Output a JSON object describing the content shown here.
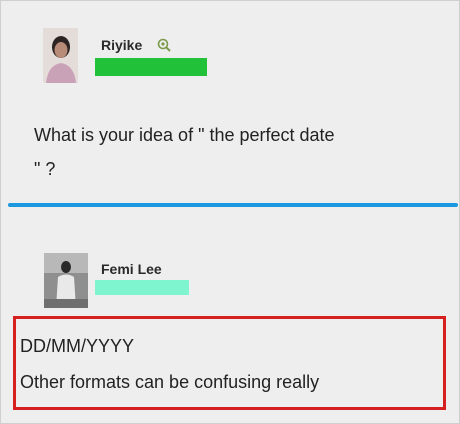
{
  "post": {
    "author": "Riyike",
    "text_line1": "What is your idea of \" the perfect date",
    "text_line2": "\" ?",
    "redaction_color": "#21c13a"
  },
  "reply": {
    "author": "Femi Lee",
    "line1": "DD/MM/YYYY",
    "line2": "Other formats can be confusing really",
    "redaction_color": "#7ef5cf"
  },
  "colors": {
    "divider": "#1a98e0",
    "highlight_border": "#d62020"
  },
  "icons": {
    "badge": "magnifier-badge-icon"
  }
}
